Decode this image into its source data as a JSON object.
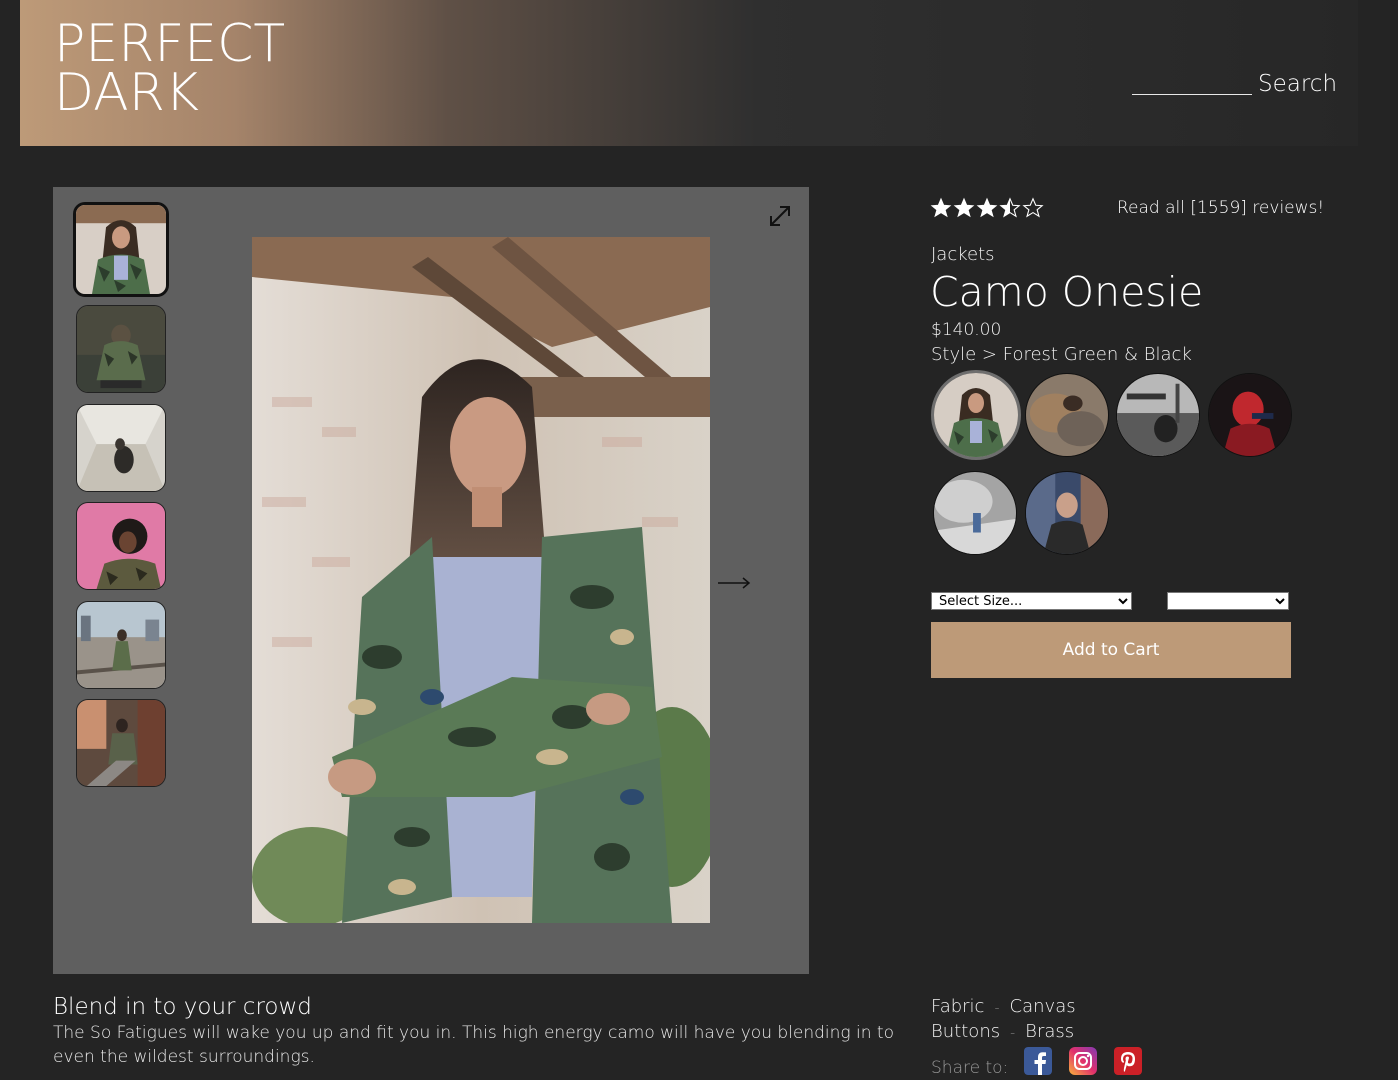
{
  "header": {
    "logo_line1": "PERFECT",
    "logo_line2": "DARK",
    "search_label": "Search",
    "search_value": ""
  },
  "gallery": {
    "thumbnail_count": 6,
    "active_thumbnail": 1,
    "expand_icon": "expand-icon",
    "next_icon": "arrow-right-icon"
  },
  "product": {
    "rating": 3.5,
    "rating_max": 5,
    "reviews_link": "Read all [1559] reviews!",
    "category": "Jackets",
    "title": "Camo Onesie",
    "price": "$140.00",
    "style_label": "Style >",
    "style_value": "Forest Green & Black",
    "style_count": 6,
    "selected_style": 1,
    "size_select_value": "Select Size...",
    "qty_select_value": "",
    "add_to_cart_label": "Add to Cart"
  },
  "description": {
    "title": "Blend in to your crowd",
    "body": "The So Fatigues will wake you up and fit you in. This high energy camo will have you blending in to even the wildest surroundings."
  },
  "features": [
    {
      "name": "Fabric",
      "sep": "-",
      "value": "Canvas"
    },
    {
      "name": "Buttons",
      "sep": "-",
      "value": "Brass"
    }
  ],
  "share": {
    "label": "Share to:",
    "networks": [
      "facebook-icon",
      "instagram-icon",
      "pinterest-icon"
    ]
  },
  "colors": {
    "accent": "#bd9a78",
    "background": "#242424",
    "gallery_bg": "#5f5f5f"
  }
}
